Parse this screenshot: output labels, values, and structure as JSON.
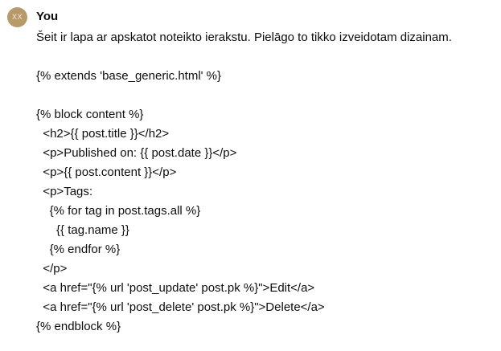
{
  "message": {
    "author": "You",
    "avatar_initials": "XX",
    "avatar_color": "#b89a6a",
    "lines": [
      "Šeit ir lapa ar apskatot noteikto ierakstu. Pielāgo to tikko izveidotam dizainam.",
      "",
      "{% extends 'base_generic.html' %}",
      "",
      "{% block content %}",
      "  <h2>{{ post.title }}</h2>",
      "  <p>Published on: {{ post.date }}</p>",
      "  <p>{{ post.content }}</p>",
      "  <p>Tags:",
      "    {% for tag in post.tags.all %}",
      "      {{ tag.name }}",
      "    {% endfor %}",
      "  </p>",
      "  <a href=\"{% url 'post_update' post.pk %}\">Edit</a>",
      "  <a href=\"{% url 'post_delete' post.pk %}\">Delete</a>",
      "{% endblock %}"
    ]
  }
}
